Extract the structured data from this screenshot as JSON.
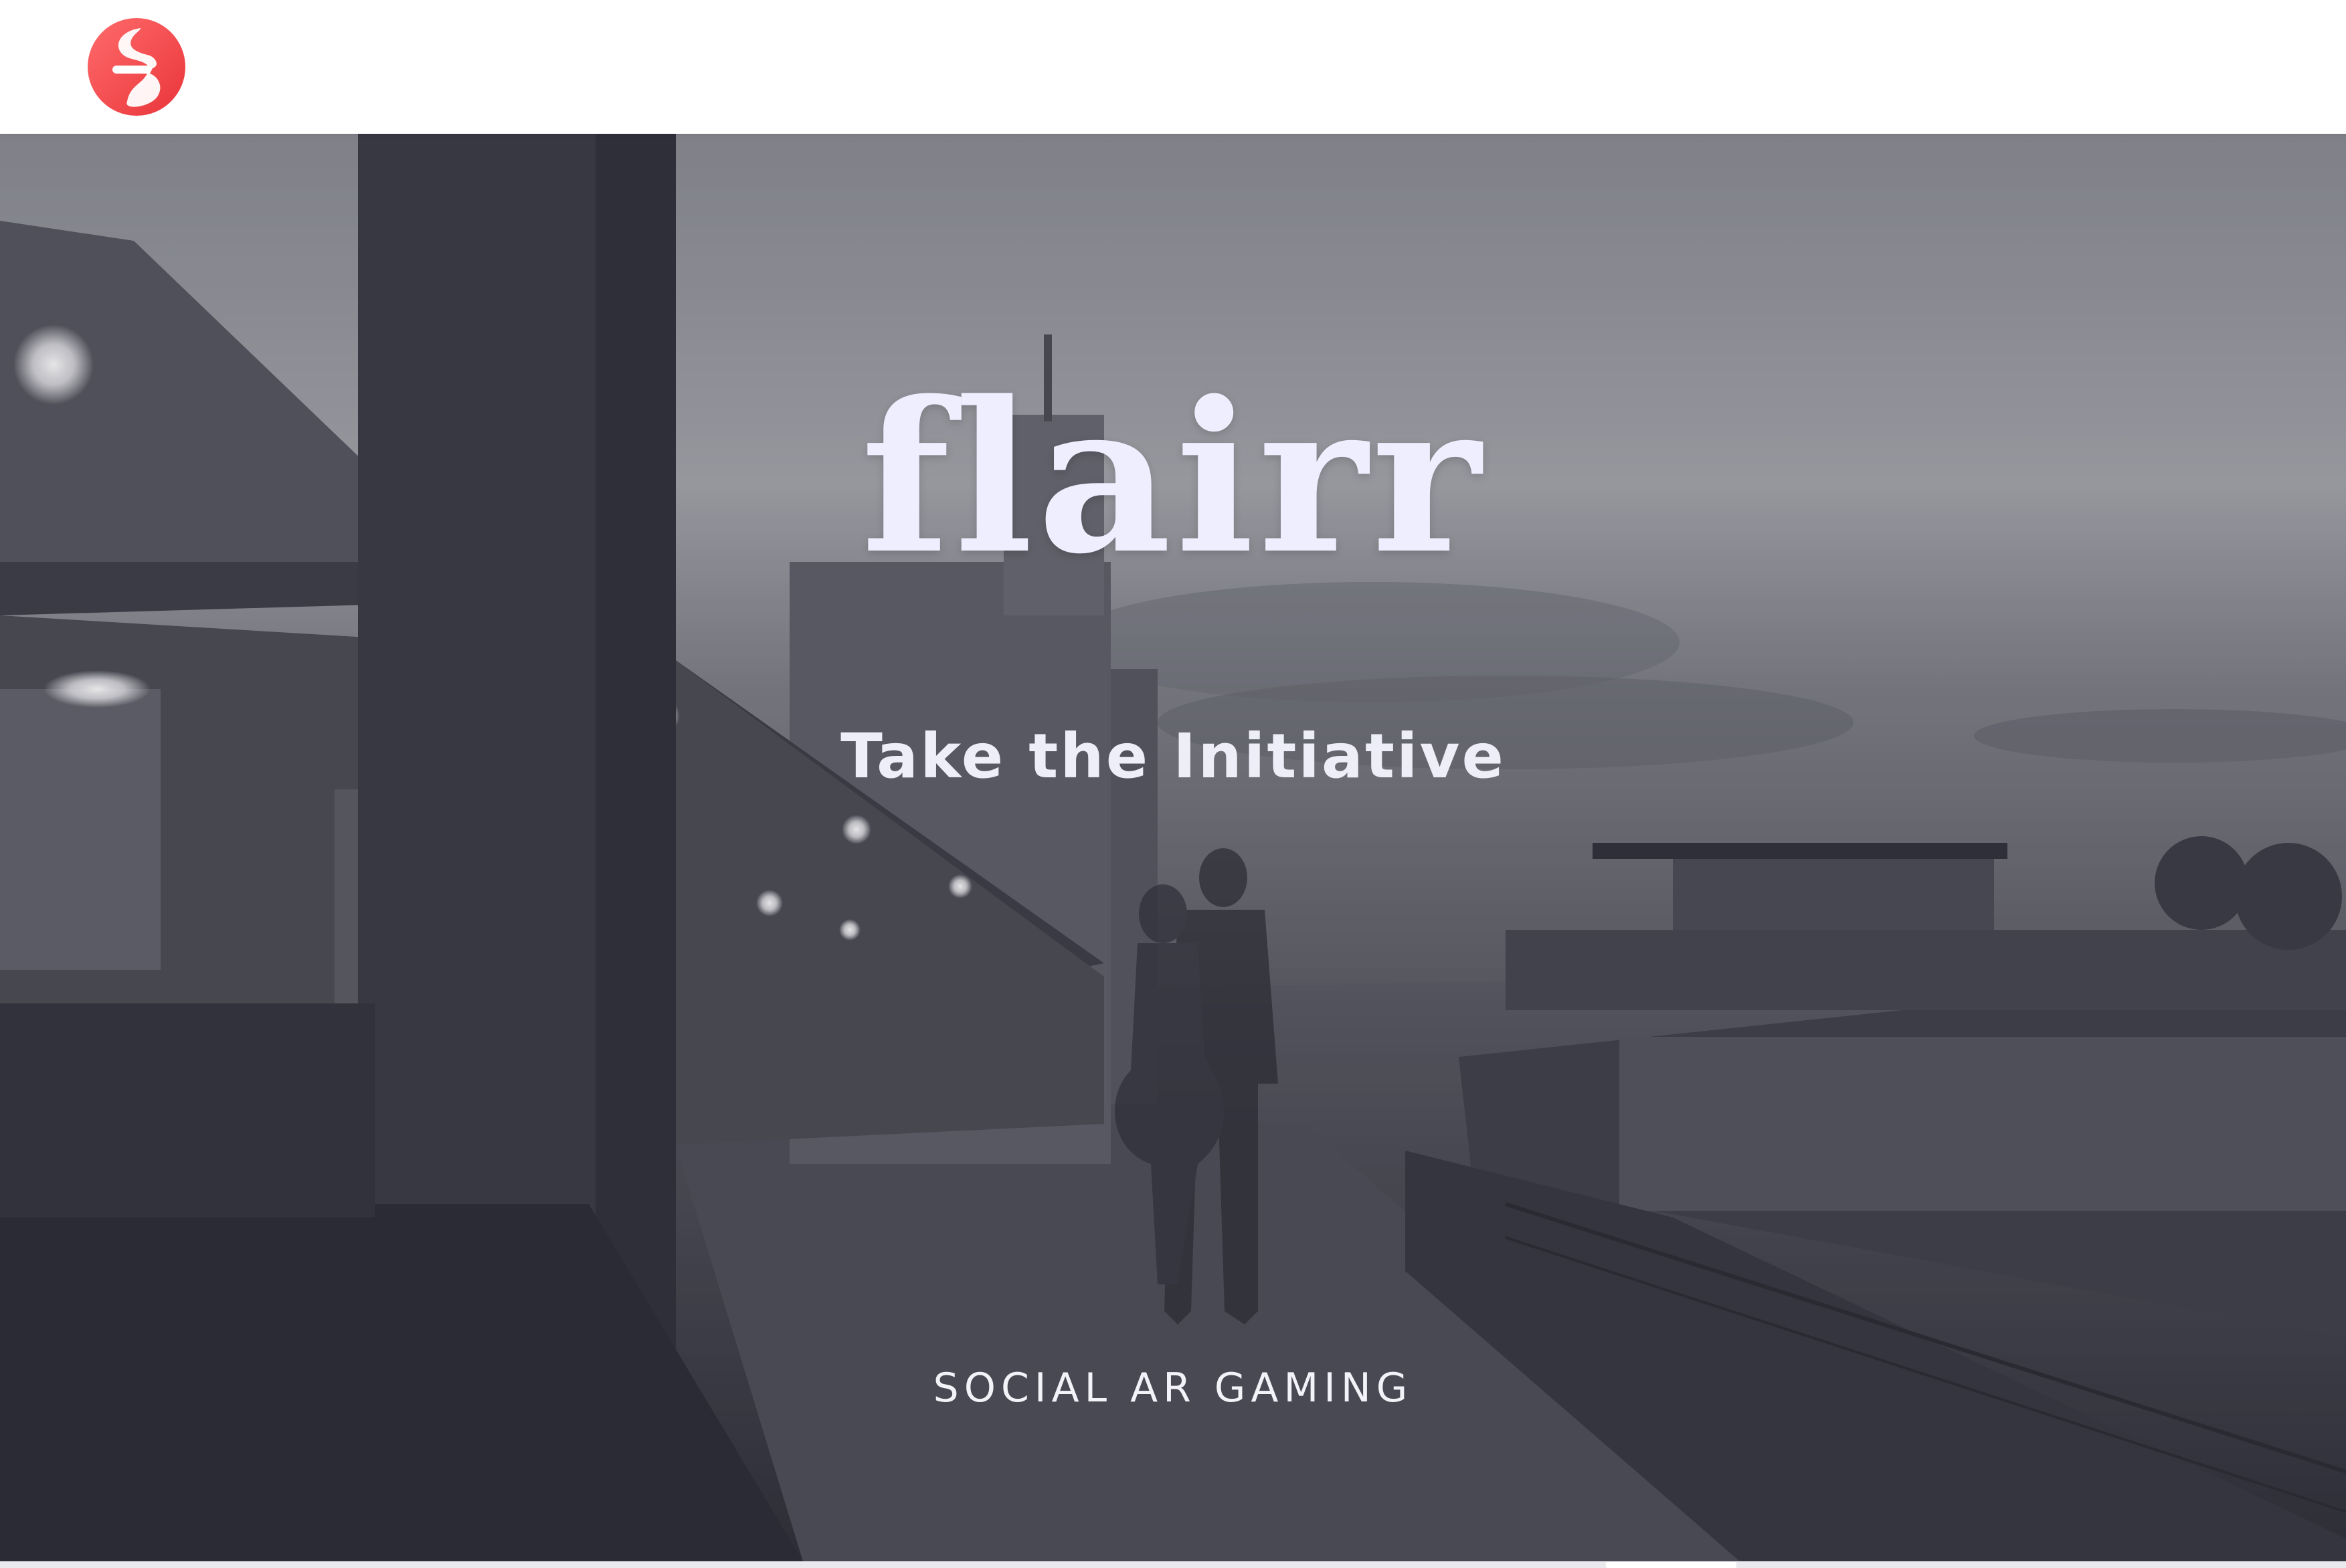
{
  "header": {
    "logo_icon": "flairr-logo-icon",
    "logo_color": "#f0494b"
  },
  "hero": {
    "title": "flairr",
    "tagline": "Take the Initiative",
    "subtitle": "SOCIAL AR GAMING",
    "text_color": "#eeeeff",
    "overlay_color": "#30303a",
    "background_image": "harbor-dusk-photo",
    "figure_icon": "couple-silhouette-icon"
  }
}
